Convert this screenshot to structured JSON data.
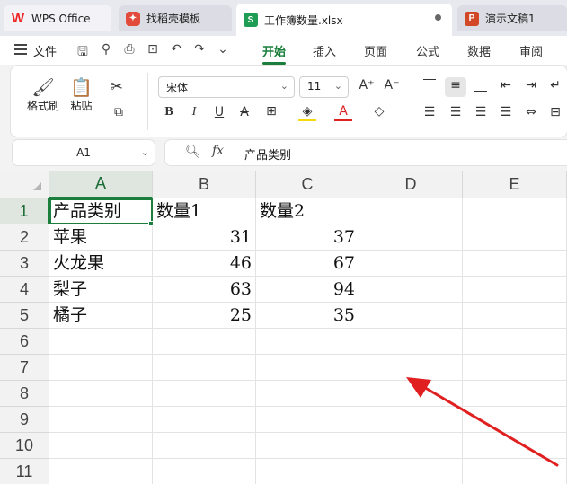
{
  "tabs": [
    {
      "label": "WPS Office",
      "icon": "wps-logo-icon"
    },
    {
      "label": "找稻壳模板",
      "icon": "docer-icon"
    },
    {
      "label": "工作簿数量.xlsx",
      "icon": "spreadsheet-icon",
      "active": true
    },
    {
      "label": "演示文稿1",
      "icon": "presentation-icon"
    }
  ],
  "menu": {
    "file_label": "文件",
    "ribbon_tabs": [
      "开始",
      "插入",
      "页面",
      "公式",
      "数据",
      "审阅"
    ],
    "active_tab": "开始"
  },
  "toolbar": {
    "format_painter": "格式刷",
    "paste": "粘贴",
    "font_name": "宋体",
    "font_size": "11"
  },
  "formula_bar": {
    "name_box": "A1",
    "fx_label": "fx",
    "value": "产品类别"
  },
  "sheet": {
    "columns": [
      "A",
      "B",
      "C",
      "D",
      "E"
    ],
    "rows": [
      "1",
      "2",
      "3",
      "4",
      "5",
      "6",
      "7",
      "8",
      "9",
      "10",
      "11"
    ],
    "header_row": [
      "产品类别",
      "数量1",
      "数量2"
    ],
    "data": [
      {
        "category": "苹果",
        "q1": "31",
        "q2": "37"
      },
      {
        "category": "火龙果",
        "q1": "46",
        "q2": "67"
      },
      {
        "category": "梨子",
        "q1": "63",
        "q2": "94"
      },
      {
        "category": "橘子",
        "q1": "25",
        "q2": "35"
      }
    ],
    "selected_cell": "A1"
  },
  "colors": {
    "accent": "#1a7f3c",
    "annotation_arrow": "#e02020"
  }
}
